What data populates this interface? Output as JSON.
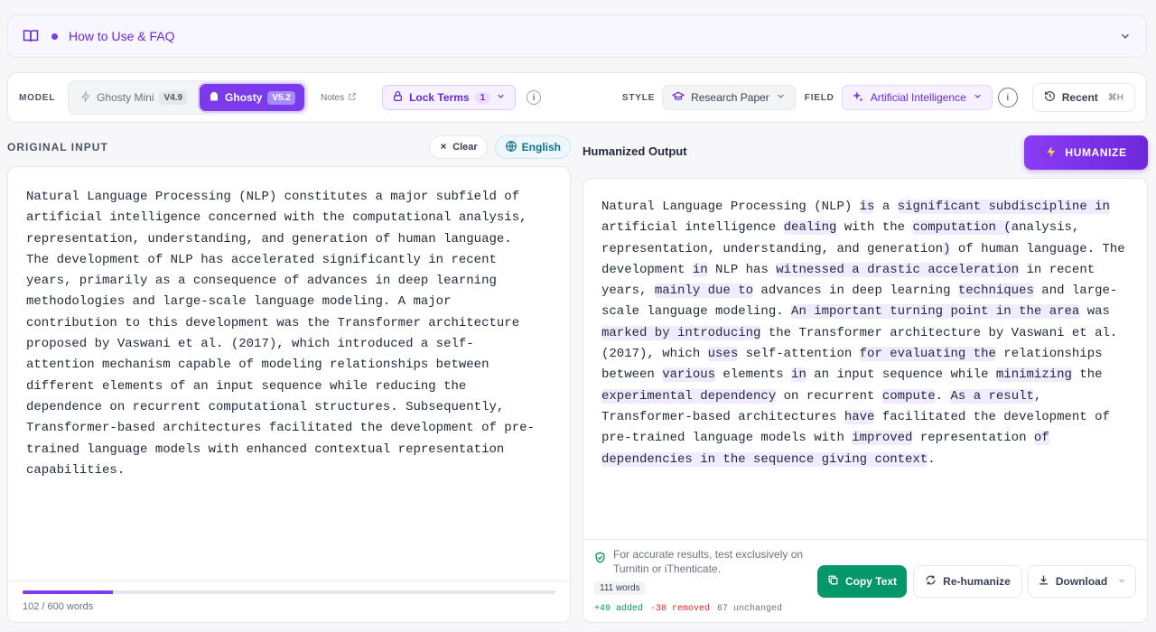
{
  "faq": {
    "title": "How to Use & FAQ"
  },
  "toolbar": {
    "model_label": "MODEL",
    "models": [
      {
        "name": "Ghosty Mini",
        "version": "V4.9"
      },
      {
        "name": "Ghosty",
        "version": "V5.2"
      }
    ],
    "notes_label": "Notes",
    "lock_terms_label": "Lock Terms",
    "lock_terms_count": "1",
    "style_label": "STYLE",
    "style_value": "Research Paper",
    "field_label": "FIELD",
    "field_value": "Artificial Intelligence",
    "recent_label": "Recent",
    "recent_shortcut": "⌘H"
  },
  "input": {
    "header": "ORIGINAL INPUT",
    "clear_label": "Clear",
    "language_label": "English",
    "text": "Natural Language Processing (NLP) constitutes a major subfield of\nartificial intelligence concerned with the computational analysis,\nrepresentation, understanding, and generation of human language.\nThe development of NLP has accelerated significantly in recent\nyears, primarily as a consequence of advances in deep learning\nmethodologies and large-scale language modeling. A major\ncontribution to this development was the Transformer architecture\nproposed by Vaswani et al. (2017), which introduced a self-\nattention mechanism capable of modeling relationships between\ndifferent elements of an input sequence while reducing the\ndependence on recurrent computational structures. Subsequently,\nTransformer-based architectures facilitated the development of pre-\ntrained language models with enhanced contextual representation\ncapabilities.",
    "word_count": "102 / 600 words",
    "progress": 0.17
  },
  "output": {
    "header": "Humanized Output",
    "humanize_label": "HUMANIZE",
    "segments": [
      {
        "t": "Natural Language Processing (NLP) ",
        "h": false
      },
      {
        "t": "is",
        "h": true
      },
      {
        "t": " a ",
        "h": false
      },
      {
        "t": "significant subdiscipline in",
        "h": true
      },
      {
        "t": " artificial intelligence ",
        "h": false
      },
      {
        "t": "dealing",
        "h": true
      },
      {
        "t": " with the ",
        "h": false
      },
      {
        "t": "computation (",
        "h": true
      },
      {
        "t": "analysis, representation, understanding, and generation",
        "h": false
      },
      {
        "t": ")",
        "h": true
      },
      {
        "t": " of human language. The development ",
        "h": false
      },
      {
        "t": "in",
        "h": true
      },
      {
        "t": " NLP has ",
        "h": false
      },
      {
        "t": "witnessed a drastic acceleration",
        "h": true
      },
      {
        "t": " in recent years, ",
        "h": false
      },
      {
        "t": "mainly due to",
        "h": true
      },
      {
        "t": " advances in deep learning ",
        "h": false
      },
      {
        "t": "techniques",
        "h": true
      },
      {
        "t": " and large-scale language modeling. ",
        "h": false
      },
      {
        "t": "An important turning point in the area",
        "h": true
      },
      {
        "t": " was ",
        "h": false
      },
      {
        "t": "marked by introducing",
        "h": true
      },
      {
        "t": " the Transformer architecture by Vaswani et al. (2017), which ",
        "h": false
      },
      {
        "t": "uses",
        "h": true
      },
      {
        "t": " self-attention ",
        "h": false
      },
      {
        "t": "for evaluating the",
        "h": true
      },
      {
        "t": " relationships between ",
        "h": false
      },
      {
        "t": "various",
        "h": true
      },
      {
        "t": " elements ",
        "h": false
      },
      {
        "t": "in",
        "h": true
      },
      {
        "t": " an input sequence while ",
        "h": false
      },
      {
        "t": "minimizing",
        "h": true
      },
      {
        "t": " the ",
        "h": false
      },
      {
        "t": "experimental dependency",
        "h": true
      },
      {
        "t": " on recurrent ",
        "h": false
      },
      {
        "t": "compute",
        "h": true
      },
      {
        "t": ". ",
        "h": false
      },
      {
        "t": "As a result",
        "h": true
      },
      {
        "t": ", Transformer-based architectures ",
        "h": false
      },
      {
        "t": "have",
        "h": true
      },
      {
        "t": " facilitated the development of pre-trained language models with ",
        "h": false
      },
      {
        "t": "improved",
        "h": true
      },
      {
        "t": " representation ",
        "h": false
      },
      {
        "t": "of dependencies in the sequence giving context",
        "h": true
      },
      {
        "t": ".",
        "h": false
      }
    ],
    "disclaimer": "For accurate results, test exclusively on Turnitin or iThenticate.",
    "word_count": "111 words",
    "added": "+49 added",
    "removed": "-38 removed",
    "unchanged": "67 unchanged",
    "copy_label": "Copy Text",
    "rehumanize_label": "Re-humanize",
    "download_label": "Download"
  },
  "colors": {
    "accent": "#7c3aed",
    "copy_green": "#059669",
    "highlight": "#f1ebff"
  }
}
